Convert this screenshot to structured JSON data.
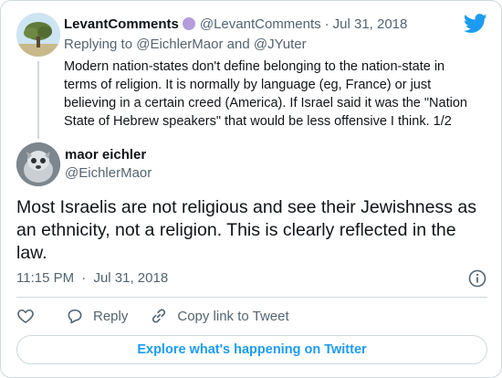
{
  "parent_tweet": {
    "author_name": "LevantComments",
    "author_handle": "@LevantComments",
    "separator": "·",
    "date": "Jul 31, 2018",
    "reply_prefix": "Replying to",
    "reply_mention_1": "@EichlerMaor",
    "reply_and": "and",
    "reply_mention_2": "@JYuter",
    "text": "Modern nation-states don't define belonging to the nation-state in terms of religion. It is normally by language (eg, France) or just believing in a certain creed (America). If Israel said it was the \"Nation State of Hebrew speakers\" that would be less offensive I think. 1/2"
  },
  "main_tweet": {
    "author_name": "maor eichler",
    "author_handle": "@EichlerMaor",
    "text": "Most Israelis are not religious and see their Jewishness as an ethnicity, not a religion. This is clearly reflected in the law.",
    "time": "11:15 PM",
    "separator": "·",
    "date": "Jul 31, 2018"
  },
  "actions": {
    "like_icon": "heart-icon",
    "reply_label": "Reply",
    "copy_link_label": "Copy link to Tweet"
  },
  "explore_button_label": "Explore what's happening on Twitter",
  "colors": {
    "accent": "#1d9bf0",
    "text_primary": "#0f1419",
    "text_secondary": "#536471",
    "border": "#cfd9de",
    "badge": "#b39ddb"
  }
}
